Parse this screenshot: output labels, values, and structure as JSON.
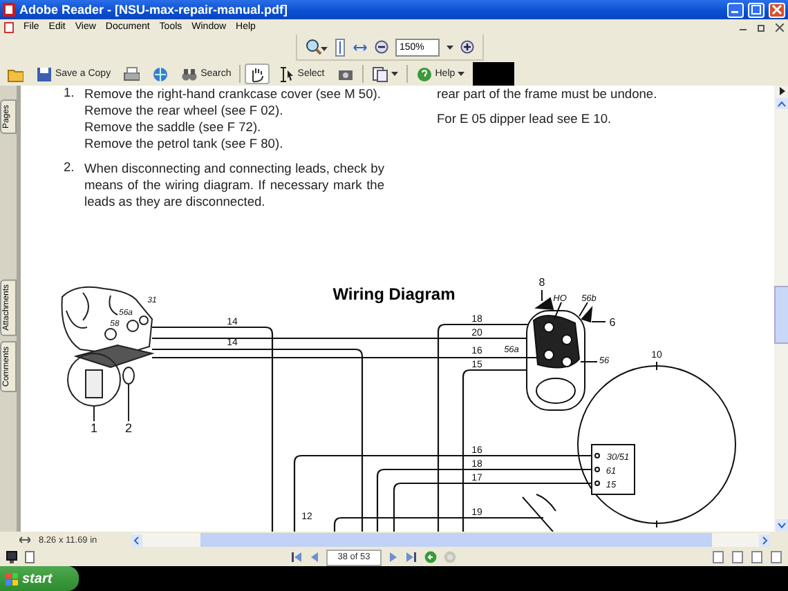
{
  "window": {
    "title": "Adobe Reader - [NSU-max-repair-manual.pdf]"
  },
  "menu": [
    "File",
    "Edit",
    "View",
    "Document",
    "Tools",
    "Window",
    "Help"
  ],
  "zoom_toolbar": {
    "zoom": "150%"
  },
  "toolbar": [
    {
      "kind": "open"
    },
    {
      "kind": "save",
      "label": "Save a Copy"
    },
    {
      "kind": "print"
    },
    {
      "kind": "email"
    },
    {
      "kind": "search",
      "label": "Search"
    },
    {
      "kind": "hand",
      "selected": true
    },
    {
      "kind": "select",
      "label": "Select",
      "selected": false
    },
    {
      "kind": "snapshot"
    },
    {
      "kind": "pages"
    },
    {
      "kind": "help",
      "label": "Help"
    },
    {
      "kind": "block"
    }
  ],
  "side_tabs": [
    {
      "label": "Pages"
    },
    {
      "label": "Attachments"
    },
    {
      "label": "Comments"
    }
  ],
  "document": {
    "left_column": [
      {
        "number": "1.",
        "lines": [
          "Remove the right-hand crankcase cover (see M 50).",
          "Remove the rear wheel (see F 02).",
          "Remove the saddle (see F 72).",
          "Remove the petrol tank (see F 80)."
        ]
      },
      {
        "number": "2.",
        "lines": [
          "When disconnecting and connecting leads, check by means of the wiring diagram. If necessary mark the leads as they are disconnected."
        ]
      }
    ],
    "right_column": [
      "rear part of the frame must be undone.",
      "For E 05 dipper lead see E 10."
    ],
    "diagram": {
      "title": "Wiring Diagram",
      "labels": [
        "1",
        "2",
        "31",
        "56a",
        "58",
        "14",
        "14",
        "12",
        "18",
        "20",
        "16",
        "15",
        "16",
        "18",
        "17",
        "19",
        "8",
        "HO",
        "56b",
        "6",
        "56a",
        "56",
        "10",
        "30/51",
        "61",
        "15"
      ]
    }
  },
  "status": {
    "page_size": "8.26 x 11.69 in"
  },
  "navigation": {
    "page": "38 of 53"
  },
  "taskbar": {
    "start": "start"
  }
}
